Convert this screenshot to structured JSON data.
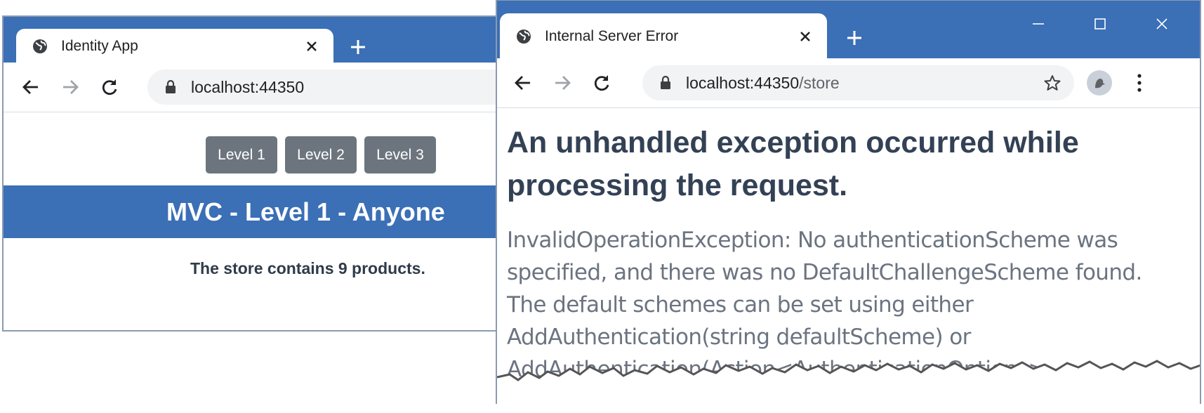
{
  "left_window": {
    "tab_title": "Identity App",
    "url": "localhost:44350",
    "buttons": [
      "Level 1",
      "Level 2",
      "Level 3"
    ],
    "banner": "MVC - Level 1 - Anyone",
    "message": "The store contains 9 products."
  },
  "right_window": {
    "tab_title": "Internal Server Error",
    "url_host": "localhost:44350",
    "url_path": "/store",
    "heading": "An unhandled exception occurred while processing the request.",
    "error_lines": [
      "InvalidOperationException: No authenticationScheme was",
      "specified, and there was no DefaultChallengeScheme found.",
      "The default schemes can be set using either",
      "AddAuthentication(string defaultScheme) or",
      "AddAuthentication(Action<AuthenticationOptions>"
    ]
  },
  "colors": {
    "titlebar": "#3b6fb6",
    "button": "#6c757d",
    "heading": "#334155"
  },
  "icons": [
    "globe-icon",
    "close-icon",
    "new-tab-icon",
    "back-icon",
    "forward-icon",
    "reload-icon",
    "lock-icon",
    "star-icon",
    "profile-icon",
    "menu-icon",
    "minimize-icon",
    "maximize-icon",
    "window-close-icon"
  ]
}
